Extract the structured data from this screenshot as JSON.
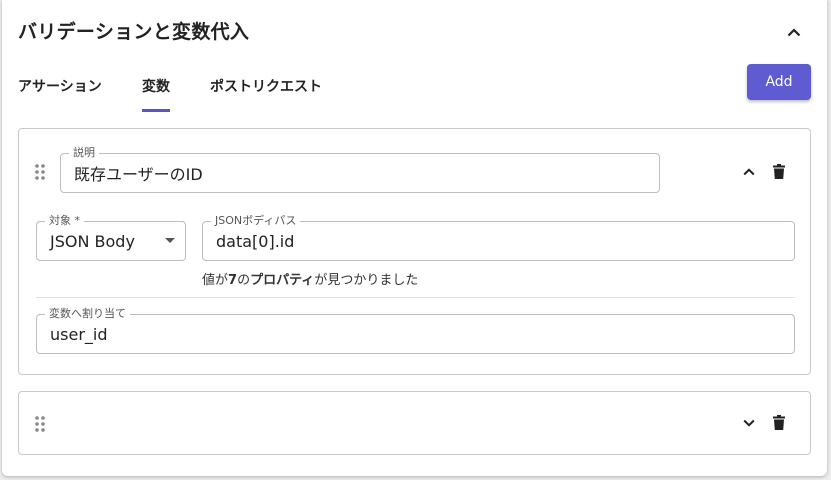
{
  "panel": {
    "title": "バリデーションと変数代入"
  },
  "tabs": [
    {
      "label": "アサーション",
      "active": false
    },
    {
      "label": "変数",
      "active": true
    },
    {
      "label": "ポストリクエスト",
      "active": false
    }
  ],
  "add_button": {
    "label": "Add"
  },
  "accent_color": "#5f5bd0",
  "card1": {
    "description": {
      "label": "説明",
      "value": "既存ユーザーのID"
    },
    "target": {
      "label": "対象 *",
      "value": "JSON Body"
    },
    "json_path": {
      "label": "JSONボディパス",
      "value": "data[0].id"
    },
    "helper": {
      "prefix": "値が",
      "count": "7",
      "middle": "の",
      "bold": "プロパティ",
      "suffix": "が見つかりました"
    },
    "assign": {
      "label": "変数へ割り当て",
      "value": "user_id"
    }
  },
  "card2": {}
}
